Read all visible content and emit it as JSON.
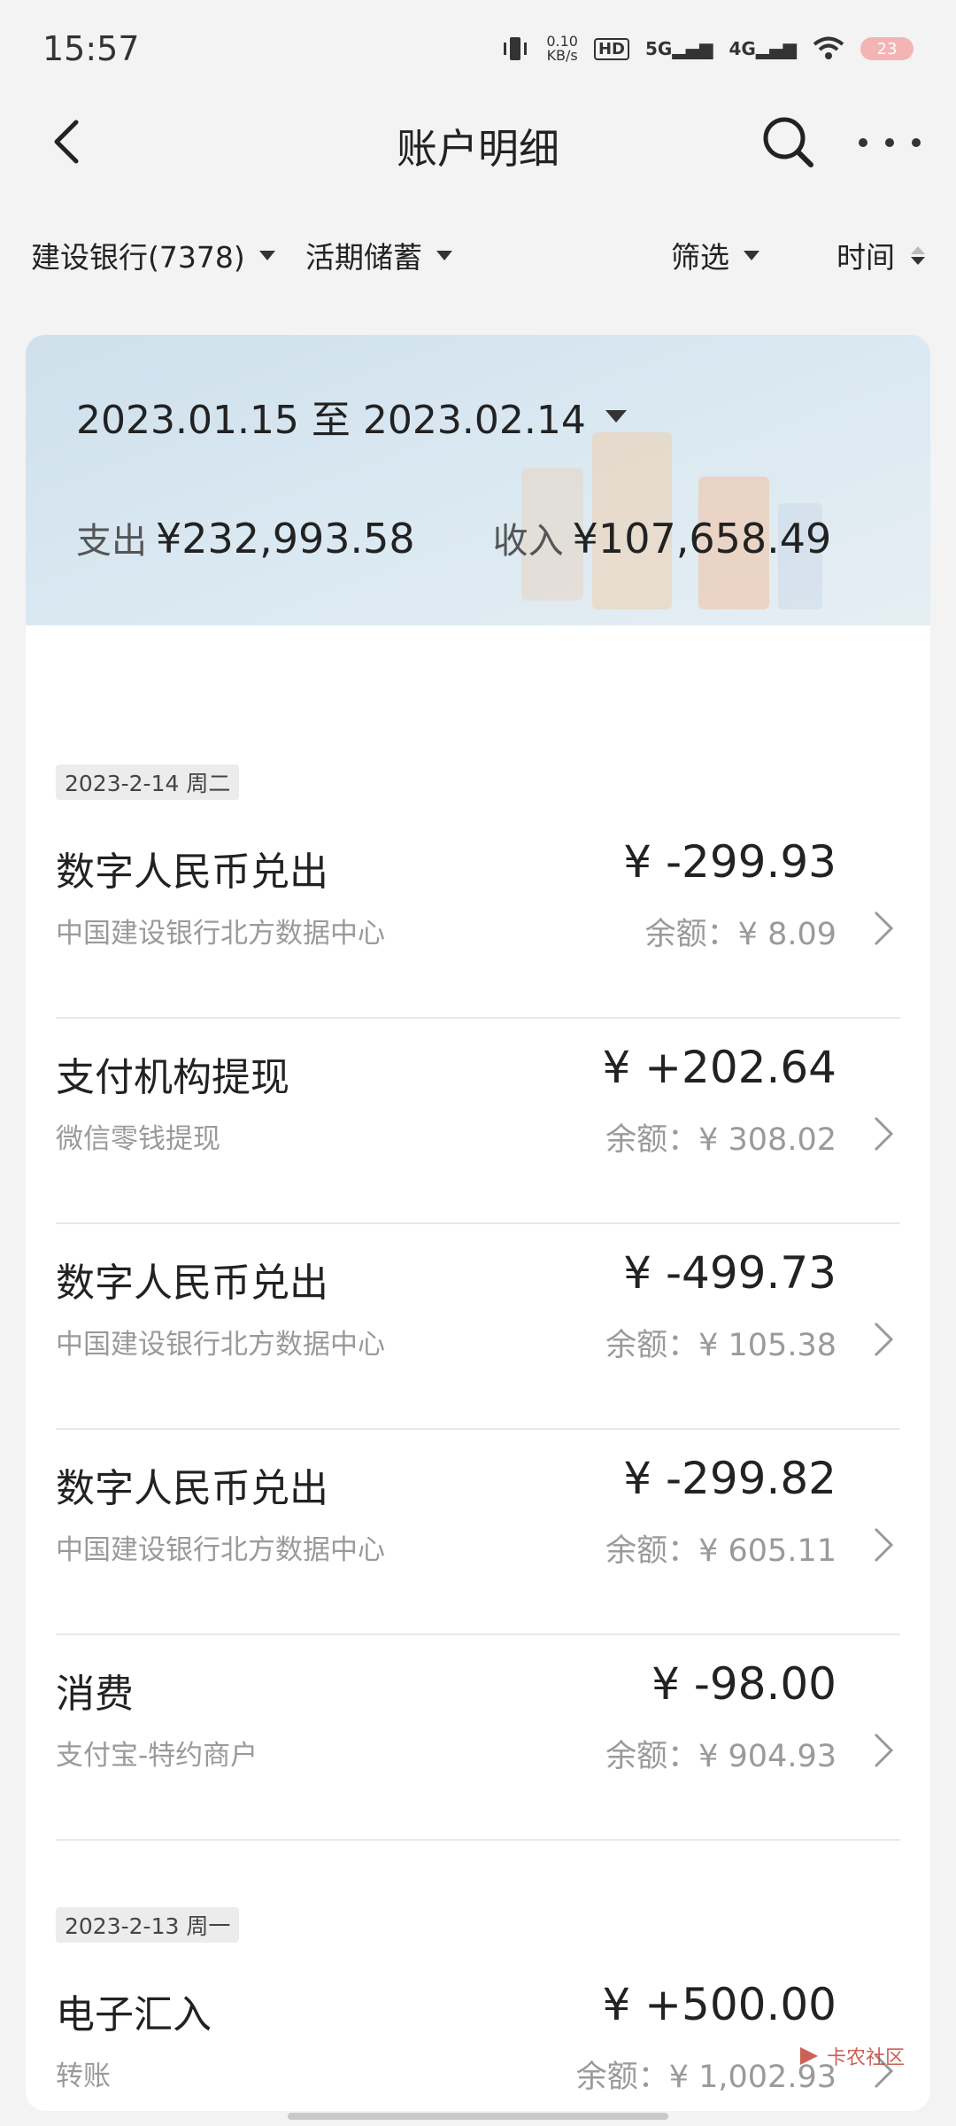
{
  "status_bar": {
    "time": "15:57",
    "net_speed_value": "0.10",
    "net_speed_unit": "KB/s",
    "hd_label": "HD",
    "signal_5g": "5G",
    "signal_4g": "4G",
    "battery": "23"
  },
  "nav": {
    "title": "账户明细"
  },
  "filters": {
    "account": "建设银行(7378)",
    "account_type": "活期储蓄",
    "filter_label": "筛选",
    "time_label": "时间"
  },
  "summary": {
    "date_range": "2023.01.15 至 2023.02.14",
    "expense_label": "支出",
    "expense_value": "¥232,993.58",
    "income_label": "收入",
    "income_value": "¥107,658.49"
  },
  "days": [
    {
      "date": "2023-2-14 周二",
      "transactions": [
        {
          "title": "数字人民币兑出",
          "amount": "¥ -299.93",
          "subtitle": "中国建设银行北方数据中心",
          "balance": "余额：¥ 8.09"
        },
        {
          "title": "支付机构提现",
          "amount": "¥ +202.64",
          "subtitle": "微信零钱提现",
          "balance": "余额：¥ 308.02"
        },
        {
          "title": "数字人民币兑出",
          "amount": "¥ -499.73",
          "subtitle": "中国建设银行北方数据中心",
          "balance": "余额：¥ 105.38"
        },
        {
          "title": "数字人民币兑出",
          "amount": "¥ -299.82",
          "subtitle": "中国建设银行北方数据中心",
          "balance": "余额：¥ 605.11"
        },
        {
          "title": "消费",
          "amount": "¥ -98.00",
          "subtitle": "支付宝-特约商户",
          "balance": "余额：¥ 904.93"
        }
      ]
    },
    {
      "date": "2023-2-13 周一",
      "transactions": [
        {
          "title": "电子汇入",
          "amount": "¥ +500.00",
          "subtitle": "转账",
          "balance": "余额：¥ 1,002.93"
        }
      ]
    }
  ],
  "watermark": "卡农社区"
}
